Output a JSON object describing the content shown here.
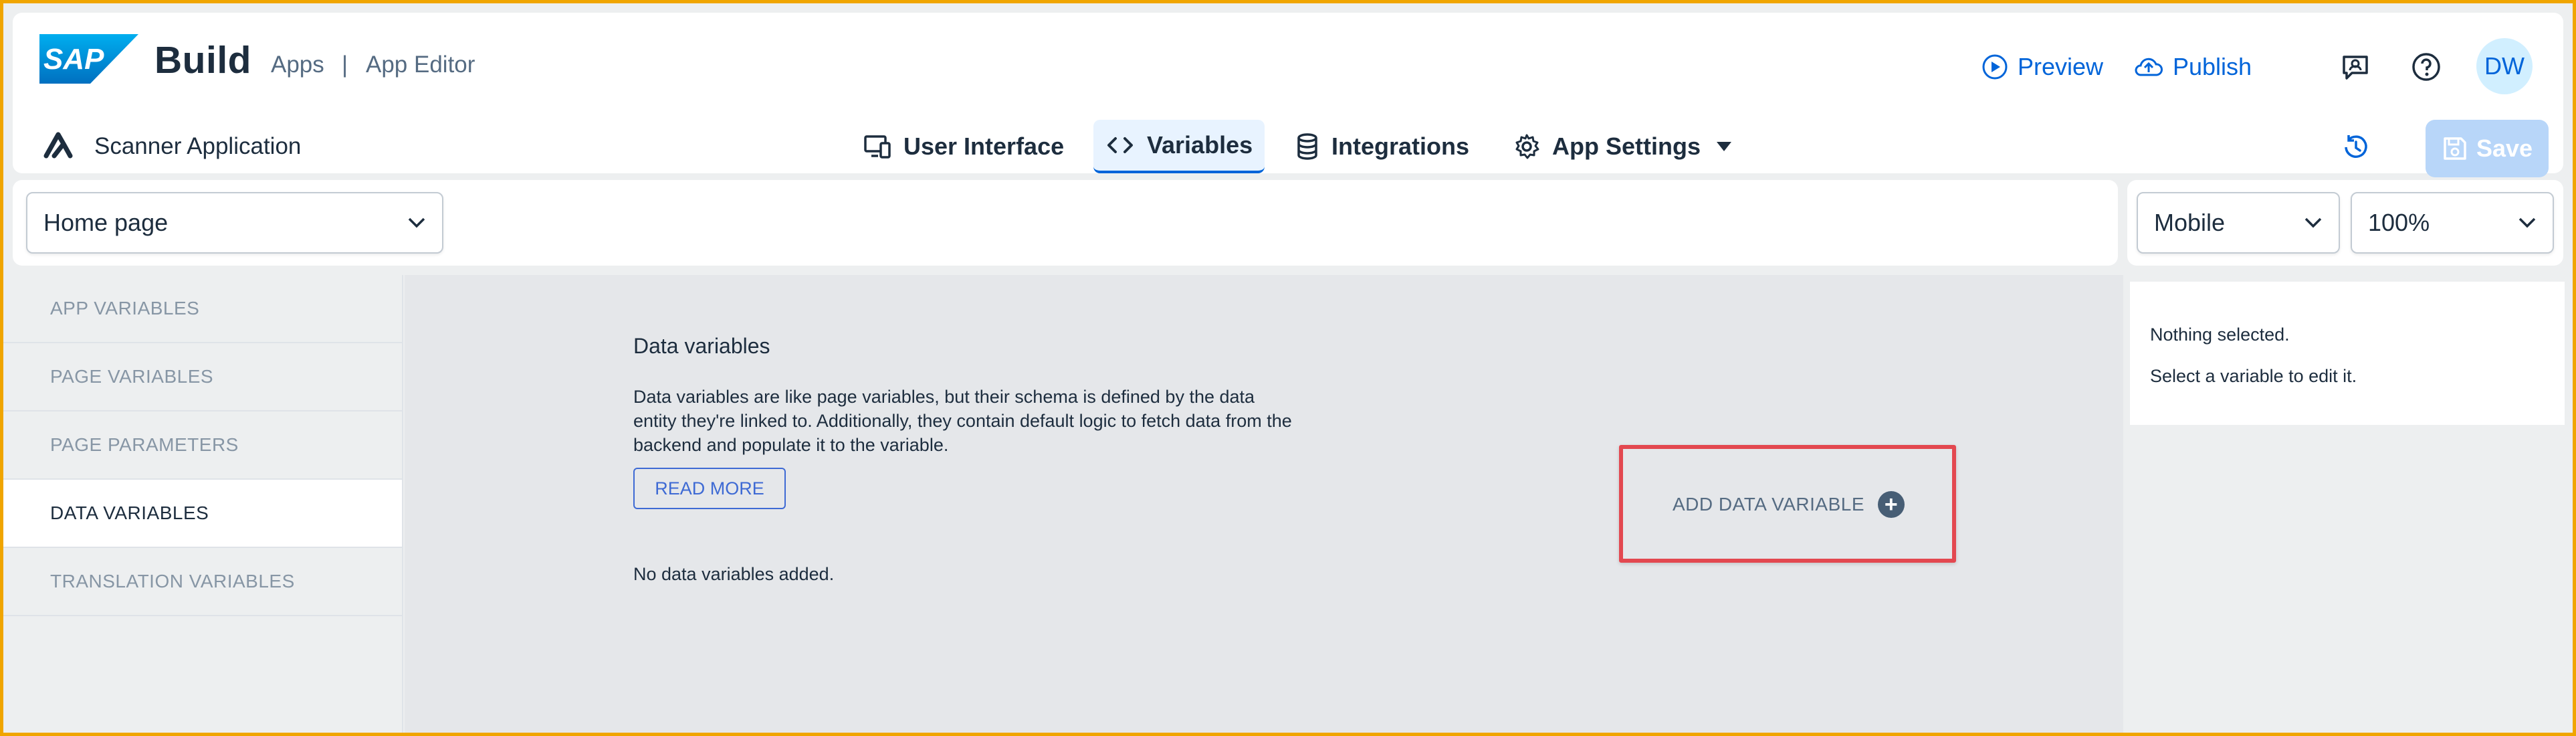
{
  "header": {
    "brand": "Build",
    "crumb_apps": "Apps",
    "crumb_sep": "|",
    "crumb_editor": "App Editor",
    "preview_label": "Preview",
    "publish_label": "Publish",
    "avatar_initials": "DW",
    "app_name": "Scanner Application",
    "tabs": [
      {
        "label": "User Interface",
        "icon": "monitor-phone-icon"
      },
      {
        "label": "Variables",
        "icon": "code-icon",
        "active": true
      },
      {
        "label": "Integrations",
        "icon": "database-icon"
      },
      {
        "label": "App Settings",
        "icon": "gear-icon"
      }
    ],
    "save_label": "Save",
    "accent_color": "#0064d9"
  },
  "toolbar": {
    "page_select": "Home page",
    "device_select": "Mobile",
    "zoom_select": "100%"
  },
  "leftnav": {
    "items": [
      {
        "label": "APP VARIABLES"
      },
      {
        "label": "PAGE VARIABLES"
      },
      {
        "label": "PAGE PARAMETERS"
      },
      {
        "label": "DATA VARIABLES",
        "active": true
      },
      {
        "label": "TRANSLATION VARIABLES"
      }
    ]
  },
  "main": {
    "title": "Data variables",
    "description": "Data variables are like page variables, but their schema is defined by the data entity they're linked to. Additionally, they contain default logic to fetch data from the backend and populate it to the variable.",
    "read_more": "READ MORE",
    "empty_text": "No data variables added.",
    "add_label": "ADD DATA VARIABLE",
    "highlight_color": "#e34850"
  },
  "properties": {
    "line1": "Nothing selected.",
    "line2": "Select a variable to edit it."
  }
}
